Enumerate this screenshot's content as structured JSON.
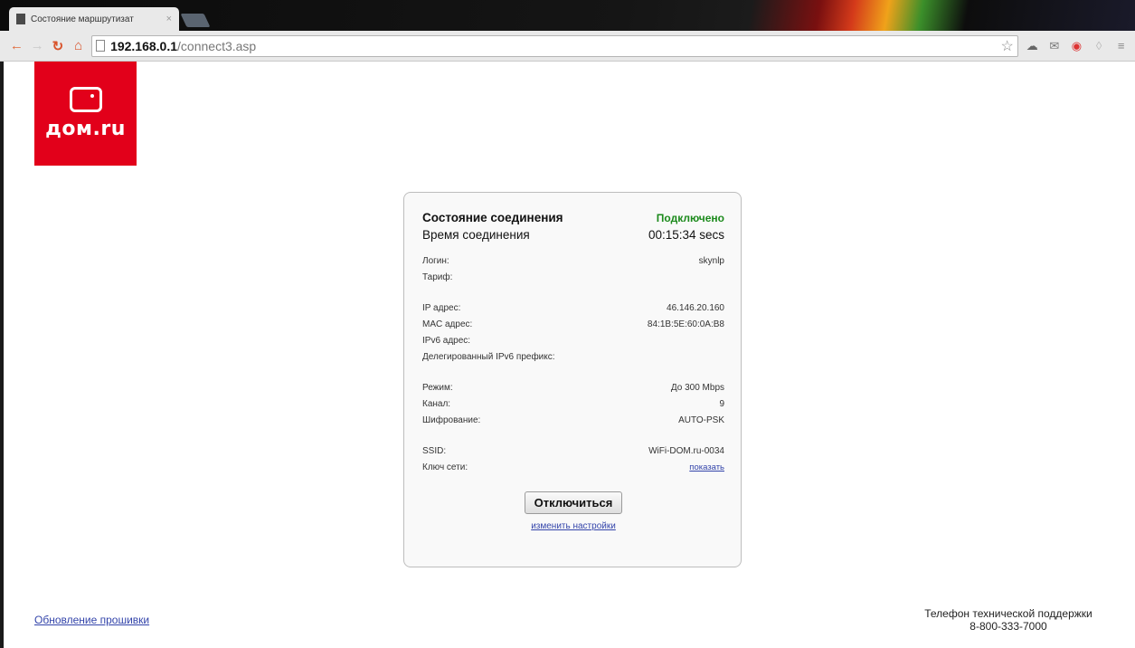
{
  "browser": {
    "tab_title": "Состояние маршрутизат",
    "tab_close": "×",
    "url_host": "192.168.0.1",
    "url_path": "/connect3.asp"
  },
  "logo": {
    "text": "дом.ru",
    "color": "#e2001a"
  },
  "status": {
    "connection_state_label": "Состояние соединения",
    "connection_state_value": "Подключено",
    "connection_time_label": "Время соединения",
    "connection_time_value": "00:15:34 secs"
  },
  "account": {
    "login_label": "Логин:",
    "login_value": "skynlp",
    "tariff_label": "Тариф:",
    "tariff_value": ""
  },
  "network": {
    "ip_label": "IP адрес:",
    "ip_value": "46.146.20.160",
    "mac_label": "MAC адрес:",
    "mac_value": "84:1B:5E:60:0A:B8",
    "ipv6_label": "IPv6 адрес:",
    "ipv6_value": "",
    "ipv6_prefix_label": "Делегированный IPv6 префикс:",
    "ipv6_prefix_value": ""
  },
  "wireless": {
    "mode_label": "Режим:",
    "mode_value": "До 300 Mbps",
    "channel_label": "Канал:",
    "channel_value": "9",
    "encryption_label": "Шифрование:",
    "encryption_value": "AUTO-PSK",
    "ssid_label": "SSID:",
    "ssid_value": "WiFi-DOM.ru-0034",
    "key_label": "Ключ сети:",
    "key_link": "показать"
  },
  "actions": {
    "disconnect_label": "Отключиться",
    "change_settings_link": "изменить настройки"
  },
  "footer": {
    "firmware_link": "Обновление прошивки",
    "support_title": "Телефон технической поддержки",
    "support_phone": "8-800-333-7000"
  },
  "colors": {
    "connected": "#1c8a1c",
    "link": "#3344aa"
  }
}
